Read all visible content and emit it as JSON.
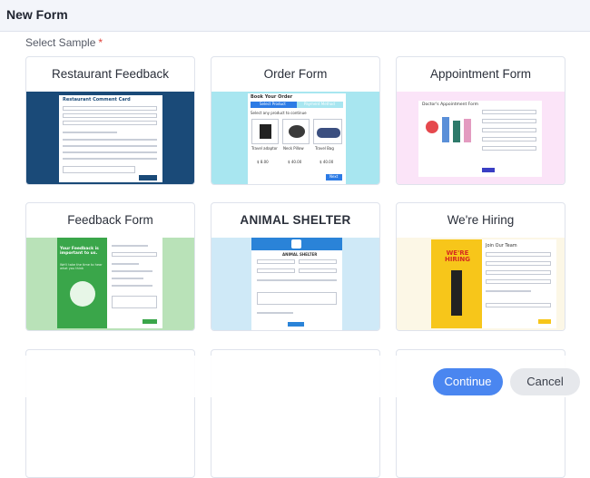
{
  "header": {
    "title": "New Form"
  },
  "select": {
    "label": "Select Sample",
    "required_mark": "*"
  },
  "cards": [
    {
      "title": "Restaurant Feedback",
      "thumb_title": "Restaurant Comment Card"
    },
    {
      "title": "Order Form",
      "thumb_title": "Book Your Order",
      "tabs": [
        "Select Product",
        "Payment Method"
      ],
      "prompt": "Select any product to continue",
      "products": [
        "Travel adaptor",
        "Neck Pillow",
        "Travel Bag"
      ],
      "prices": [
        "$ 8.00",
        "$ 40.00",
        "$ 40.00"
      ],
      "next": "Next"
    },
    {
      "title": "Appointment Form",
      "thumb_title": "Doctor's Appointment Form"
    },
    {
      "title": "Feedback Form",
      "thumb_title": "Your Feedback is important to us.",
      "thumb_sub": "We'll take the time to hear what you think"
    },
    {
      "title": "ANIMAL SHELTER",
      "thumb_title": "ANIMAL SHELTER"
    },
    {
      "title": "We're Hiring",
      "thumb_title": "Join Our Team",
      "poster": "WE'RE HIRING"
    }
  ],
  "buttons": {
    "continue": "Continue",
    "cancel": "Cancel"
  },
  "colors": {
    "accent": "#4a86f0",
    "restaurant_bg": "#1a4a78",
    "order_bg": "#a8e6f0",
    "appointment_bg": "#fbe4f8",
    "feedback_bg": "#b9e2b8",
    "animal_bg": "#cfe9f7",
    "hiring_bg": "#fcf7e6"
  }
}
